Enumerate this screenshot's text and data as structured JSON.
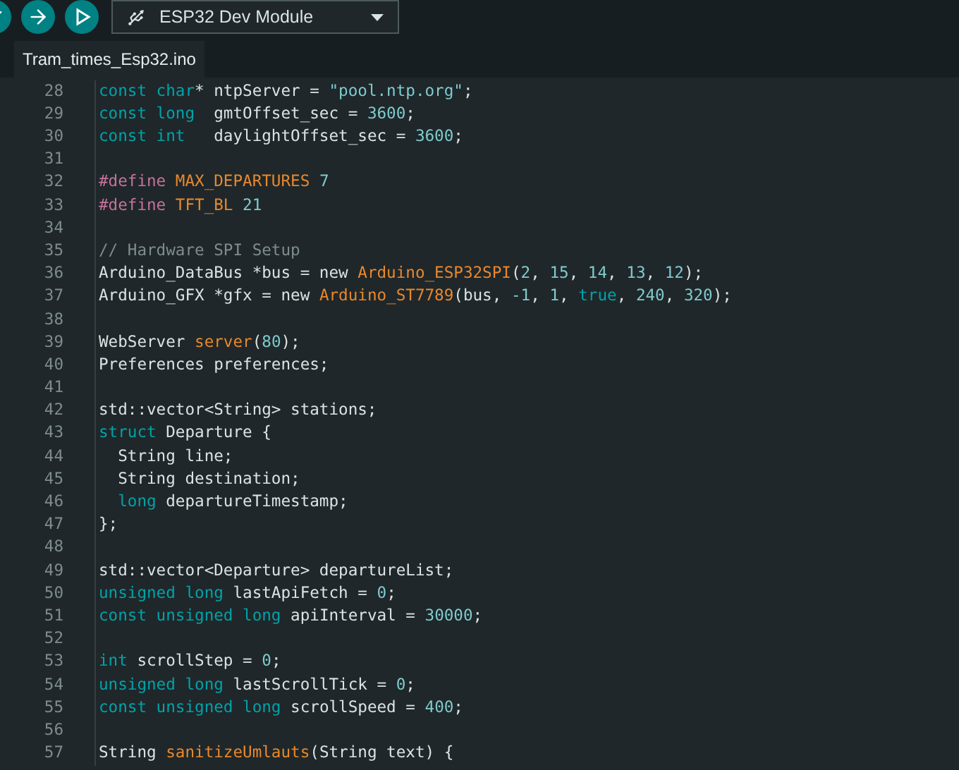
{
  "toolbar": {
    "board": {
      "label": "ESP32 Dev Module"
    }
  },
  "tabs": [
    {
      "label": "Tram_times_Esp32.ino",
      "selected": true
    }
  ],
  "editor": {
    "lines": [
      {
        "number": "28",
        "tokens": [
          {
            "kind": "keyword",
            "text": "const char"
          },
          {
            "kind": "plain",
            "text": "* ntpServer = "
          },
          {
            "kind": "string",
            "text": "\"pool.ntp.org\""
          },
          {
            "kind": "plain",
            "text": ";"
          }
        ]
      },
      {
        "number": "29",
        "tokens": [
          {
            "kind": "keyword",
            "text": "const long"
          },
          {
            "kind": "plain",
            "text": "  gmtOffset_sec = "
          },
          {
            "kind": "number",
            "text": "3600"
          },
          {
            "kind": "plain",
            "text": ";"
          }
        ]
      },
      {
        "number": "30",
        "tokens": [
          {
            "kind": "keyword",
            "text": "const int"
          },
          {
            "kind": "plain",
            "text": "   daylightOffset_sec = "
          },
          {
            "kind": "number",
            "text": "3600"
          },
          {
            "kind": "plain",
            "text": ";"
          }
        ]
      },
      {
        "number": "31"
      },
      {
        "number": "32",
        "tokens": [
          {
            "kind": "directive",
            "text": "#define "
          },
          {
            "kind": "function",
            "text": "MAX_DEPARTURES "
          },
          {
            "kind": "number",
            "text": "7"
          }
        ]
      },
      {
        "number": "33",
        "tokens": [
          {
            "kind": "directive",
            "text": "#define "
          },
          {
            "kind": "function",
            "text": "TFT_BL "
          },
          {
            "kind": "number",
            "text": "21"
          }
        ]
      },
      {
        "number": "34"
      },
      {
        "number": "35",
        "tokens": [
          {
            "kind": "comment",
            "text": "// Hardware SPI Setup"
          }
        ]
      },
      {
        "number": "36",
        "tokens": [
          {
            "kind": "plain",
            "text": "Arduino_DataBus *bus = new "
          },
          {
            "kind": "function",
            "text": "Arduino_ESP32SPI"
          },
          {
            "kind": "plain",
            "text": "("
          },
          {
            "kind": "number",
            "text": "2"
          },
          {
            "kind": "plain",
            "text": ", "
          },
          {
            "kind": "number",
            "text": "15"
          },
          {
            "kind": "plain",
            "text": ", "
          },
          {
            "kind": "number",
            "text": "14"
          },
          {
            "kind": "plain",
            "text": ", "
          },
          {
            "kind": "number",
            "text": "13"
          },
          {
            "kind": "plain",
            "text": ", "
          },
          {
            "kind": "number",
            "text": "12"
          },
          {
            "kind": "plain",
            "text": ");"
          }
        ]
      },
      {
        "number": "37",
        "tokens": [
          {
            "kind": "plain",
            "text": "Arduino_GFX *gfx = new "
          },
          {
            "kind": "function",
            "text": "Arduino_ST7789"
          },
          {
            "kind": "plain",
            "text": "(bus, "
          },
          {
            "kind": "number",
            "text": "-1"
          },
          {
            "kind": "plain",
            "text": ", "
          },
          {
            "kind": "number",
            "text": "1"
          },
          {
            "kind": "plain",
            "text": ", "
          },
          {
            "kind": "keyword",
            "text": "true"
          },
          {
            "kind": "plain",
            "text": ", "
          },
          {
            "kind": "number",
            "text": "240"
          },
          {
            "kind": "plain",
            "text": ", "
          },
          {
            "kind": "number",
            "text": "320"
          },
          {
            "kind": "plain",
            "text": ");"
          }
        ]
      },
      {
        "number": "38"
      },
      {
        "number": "39",
        "tokens": [
          {
            "kind": "plain",
            "text": "WebServer "
          },
          {
            "kind": "function",
            "text": "server"
          },
          {
            "kind": "plain",
            "text": "("
          },
          {
            "kind": "number",
            "text": "80"
          },
          {
            "kind": "plain",
            "text": ");"
          }
        ]
      },
      {
        "number": "40",
        "tokens": [
          {
            "kind": "plain",
            "text": "Preferences preferences;"
          }
        ]
      },
      {
        "number": "41"
      },
      {
        "number": "42",
        "tokens": [
          {
            "kind": "plain",
            "text": "std::vector<String> stations;"
          }
        ]
      },
      {
        "number": "43",
        "tokens": [
          {
            "kind": "keyword",
            "text": "struct"
          },
          {
            "kind": "plain",
            "text": " Departure {"
          }
        ]
      },
      {
        "number": "44",
        "tokens": [
          {
            "kind": "plain",
            "text": "  String line;"
          }
        ]
      },
      {
        "number": "45",
        "tokens": [
          {
            "kind": "plain",
            "text": "  String destination;"
          }
        ]
      },
      {
        "number": "46",
        "tokens": [
          {
            "kind": "keyword",
            "text": "  long"
          },
          {
            "kind": "plain",
            "text": " departureTimestamp;"
          }
        ]
      },
      {
        "number": "47",
        "tokens": [
          {
            "kind": "plain",
            "text": "};"
          }
        ]
      },
      {
        "number": "48"
      },
      {
        "number": "49",
        "tokens": [
          {
            "kind": "plain",
            "text": "std::vector<Departure> departureList;"
          }
        ]
      },
      {
        "number": "50",
        "tokens": [
          {
            "kind": "keyword",
            "text": "unsigned long"
          },
          {
            "kind": "plain",
            "text": " lastApiFetch = "
          },
          {
            "kind": "number",
            "text": "0"
          },
          {
            "kind": "plain",
            "text": ";"
          }
        ]
      },
      {
        "number": "51",
        "tokens": [
          {
            "kind": "keyword",
            "text": "const unsigned long"
          },
          {
            "kind": "plain",
            "text": " apiInterval = "
          },
          {
            "kind": "number",
            "text": "30000"
          },
          {
            "kind": "plain",
            "text": ";"
          }
        ]
      },
      {
        "number": "52"
      },
      {
        "number": "53",
        "tokens": [
          {
            "kind": "keyword",
            "text": "int"
          },
          {
            "kind": "plain",
            "text": " scrollStep = "
          },
          {
            "kind": "number",
            "text": "0"
          },
          {
            "kind": "plain",
            "text": ";"
          }
        ]
      },
      {
        "number": "54",
        "tokens": [
          {
            "kind": "keyword",
            "text": "unsigned long"
          },
          {
            "kind": "plain",
            "text": " lastScrollTick = "
          },
          {
            "kind": "number",
            "text": "0"
          },
          {
            "kind": "plain",
            "text": ";"
          }
        ]
      },
      {
        "number": "55",
        "tokens": [
          {
            "kind": "keyword",
            "text": "const unsigned long"
          },
          {
            "kind": "plain",
            "text": " scrollSpeed = "
          },
          {
            "kind": "number",
            "text": "400"
          },
          {
            "kind": "plain",
            "text": ";"
          }
        ]
      },
      {
        "number": "56"
      },
      {
        "number": "57",
        "tokens": [
          {
            "kind": "plain",
            "text": "String "
          },
          {
            "kind": "function",
            "text": "sanitizeUmlauts"
          },
          {
            "kind": "plain",
            "text": "(String text) {"
          }
        ]
      }
    ]
  }
}
